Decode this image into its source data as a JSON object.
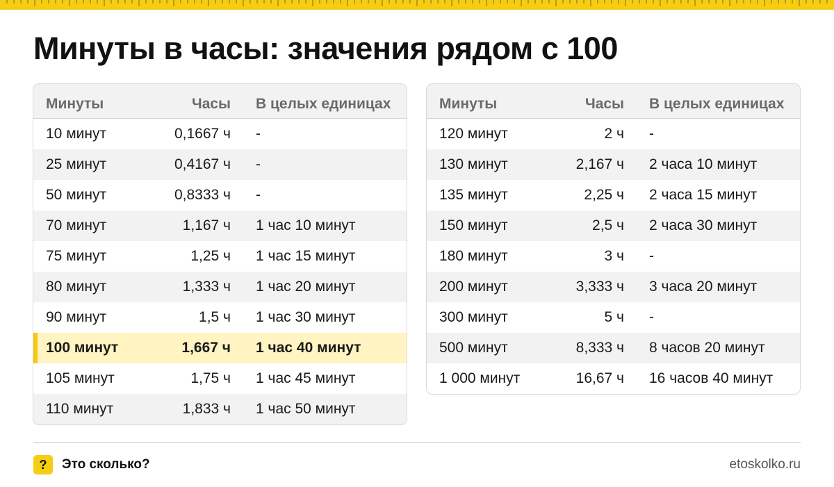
{
  "colors": {
    "accent": "#f6cd12",
    "highlight_bg": "#fff4c2",
    "row_alt": "#f2f2f2",
    "header_text": "#6a6a6a"
  },
  "title": "Минуты в часы: значения рядом с 100",
  "headers": {
    "minutes": "Минуты",
    "hours": "Часы",
    "whole": "В целых единицах"
  },
  "left_table": {
    "rows": [
      {
        "minutes": "10 минут",
        "hours": "0,1667 ч",
        "whole": "-"
      },
      {
        "minutes": "25 минут",
        "hours": "0,4167 ч",
        "whole": "-"
      },
      {
        "minutes": "50 минут",
        "hours": "0,8333 ч",
        "whole": "-"
      },
      {
        "minutes": "70 минут",
        "hours": "1,167 ч",
        "whole": "1 час 10 минут"
      },
      {
        "minutes": "75 минут",
        "hours": "1,25 ч",
        "whole": "1 час 15 минут"
      },
      {
        "minutes": "80 минут",
        "hours": "1,333 ч",
        "whole": "1 час 20 минут"
      },
      {
        "minutes": "90 минут",
        "hours": "1,5 ч",
        "whole": "1 час 30 минут"
      },
      {
        "minutes": "100 минут",
        "hours": "1,667 ч",
        "whole": "1 час 40 минут",
        "highlighted": true
      },
      {
        "minutes": "105 минут",
        "hours": "1,75 ч",
        "whole": "1 час 45 минут"
      },
      {
        "minutes": "110 минут",
        "hours": "1,833 ч",
        "whole": "1 час 50 минут"
      }
    ]
  },
  "right_table": {
    "rows": [
      {
        "minutes": "120 минут",
        "hours": "2 ч",
        "whole": "-"
      },
      {
        "minutes": "130 минут",
        "hours": "2,167 ч",
        "whole": "2 часа 10 минут"
      },
      {
        "minutes": "135 минут",
        "hours": "2,25 ч",
        "whole": "2 часа 15 минут"
      },
      {
        "minutes": "150 минут",
        "hours": "2,5 ч",
        "whole": "2 часа 30 минут"
      },
      {
        "minutes": "180 минут",
        "hours": "3 ч",
        "whole": "-"
      },
      {
        "minutes": "200 минут",
        "hours": "3,333 ч",
        "whole": "3 часа 20 минут"
      },
      {
        "minutes": "300 минут",
        "hours": "5 ч",
        "whole": "-"
      },
      {
        "minutes": "500 минут",
        "hours": "8,333 ч",
        "whole": "8 часов 20 минут"
      },
      {
        "minutes": "1 000 минут",
        "hours": "16,67 ч",
        "whole": "16 часов 40 минут"
      }
    ]
  },
  "footer": {
    "badge": "?",
    "brand": "Это сколько?",
    "site": "etoskolko.ru"
  }
}
